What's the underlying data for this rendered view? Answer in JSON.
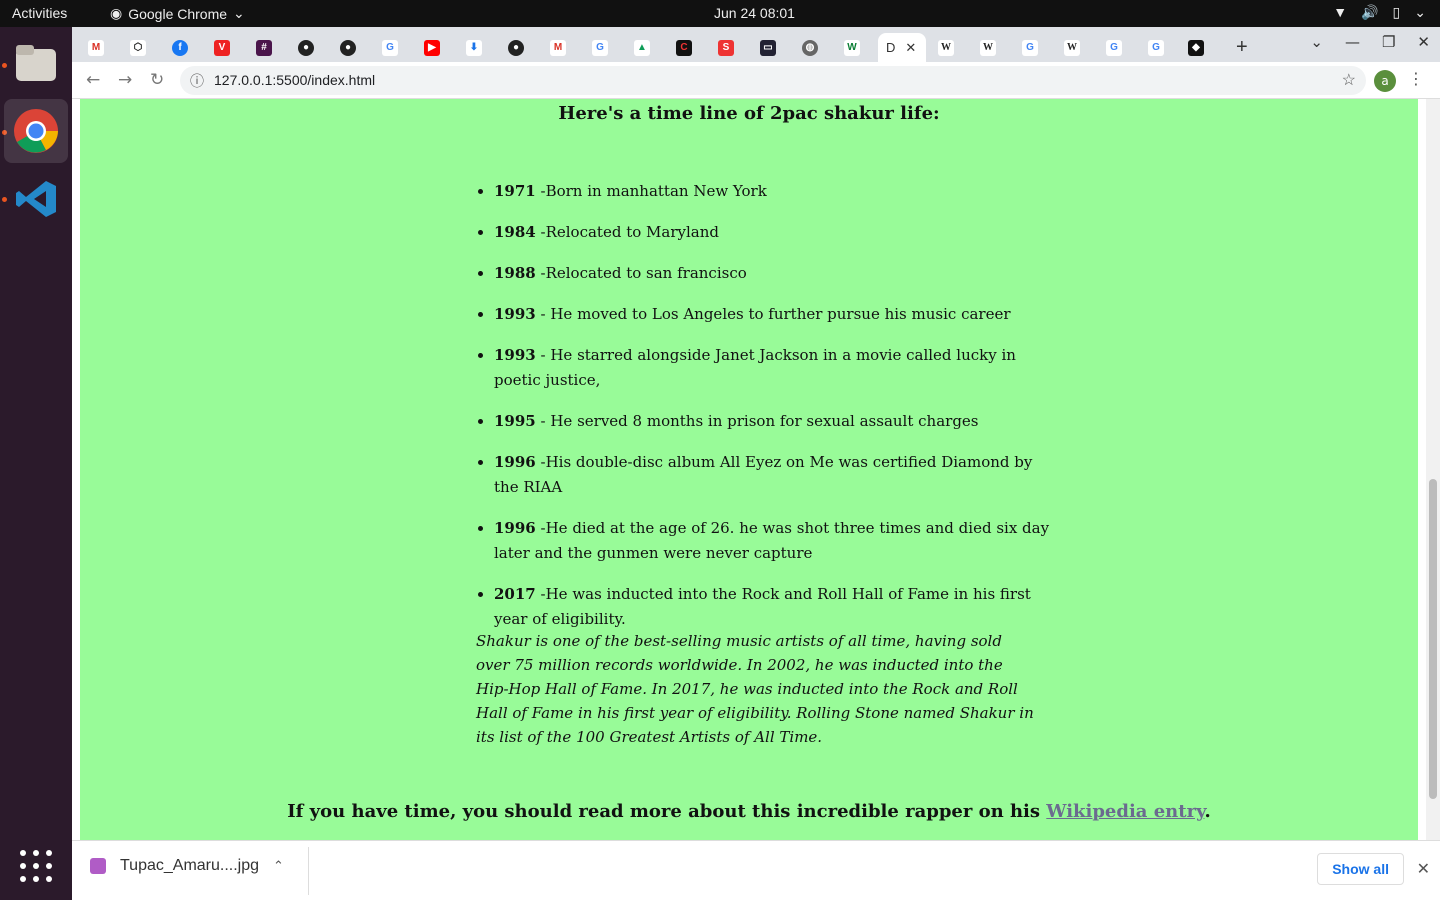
{
  "system": {
    "activities": "Activities",
    "app_name": "Google Chrome",
    "clock": "Jun 24  08:01"
  },
  "browser": {
    "url": "127.0.0.1:5500/index.html",
    "profile_initial": "a",
    "active_tab_label": "D"
  },
  "page": {
    "heading": "Here's a time line of 2pac shakur life:",
    "timeline": [
      {
        "year": "1971",
        "text": " -Born in manhattan New York"
      },
      {
        "year": "1984",
        "text": " -Relocated to Maryland"
      },
      {
        "year": "1988",
        "text": " -Relocated to san francisco"
      },
      {
        "year": "1993",
        "text": " - He moved to Los Angeles to further pursue his music career"
      },
      {
        "year": "1993",
        "text": " - He starred alongside Janet Jackson in a movie called lucky in poetic justice,"
      },
      {
        "year": "1995",
        "text": " - He served 8 months in prison for sexual assault charges"
      },
      {
        "year": "1996",
        "text": " -His double-disc album All Eyez on Me was certified Diamond by the RIAA"
      },
      {
        "year": "1996",
        "text": " -He died at the age of 26. he was shot three times and died six day later and the gunmen were never capture"
      },
      {
        "year": "2017",
        "text": " -He was inducted into the Rock and Roll Hall of Fame in his first year of eligibility."
      }
    ],
    "quote": "Shakur is one of the best-selling music artists of all time, having sold over 75 million records worldwide. In 2002, he was inducted into the Hip-Hop Hall of Fame. In 2017, he was inducted into the Rock and Roll Hall of Fame in his first year of eligibility. Rolling Stone named Shakur in its list of the 100 Greatest Artists of All Time.",
    "closing_prefix": "If you have time, you should read more about this incredible rapper on his ",
    "closing_link": "Wikipedia entry",
    "closing_suffix": "."
  },
  "downloads": {
    "file_name": "Tupac_Amaru....jpg",
    "show_all": "Show all"
  },
  "colors": {
    "page_background": "#98fb98",
    "link": "#6b6b8f"
  }
}
